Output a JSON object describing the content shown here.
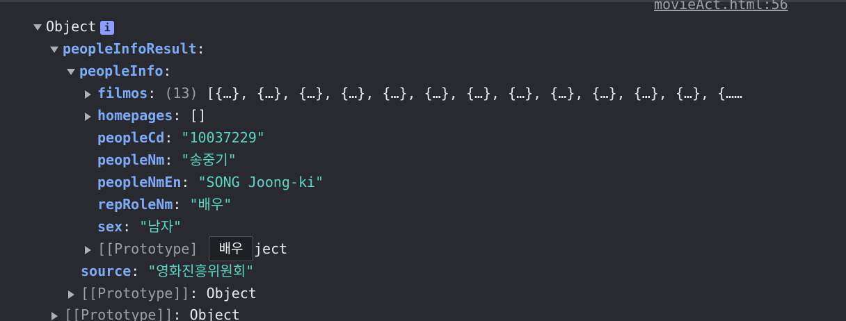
{
  "source_link": "movieAct.html:56",
  "root": {
    "label": "Object",
    "info_icon": "i"
  },
  "peopleInfoResult": {
    "key": "peopleInfoResult",
    "colon": ":"
  },
  "peopleInfo": {
    "key": "peopleInfo",
    "colon": ":"
  },
  "filmos": {
    "key": "filmos",
    "colon": ":",
    "count": "(13)",
    "preview": "[{…}, {…}, {…}, {…}, {…}, {…}, {…}, {…}, {…}, {…}, {…}, {…}, {……"
  },
  "homepages": {
    "key": "homepages",
    "colon": ":",
    "value": "[]"
  },
  "peopleCd": {
    "key": "peopleCd",
    "colon": ":",
    "value": "\"10037229\""
  },
  "peopleNm": {
    "key": "peopleNm",
    "colon": ":",
    "value": "\"송중기\""
  },
  "peopleNmEn": {
    "key": "peopleNmEn",
    "colon": ":",
    "value": "\"SONG Joong-ki\""
  },
  "repRoleNm": {
    "key": "repRoleNm",
    "colon": ":",
    "value": "\"배우\""
  },
  "sex": {
    "key": "sex",
    "colon": ":",
    "value": "\"남자\""
  },
  "proto_inner": {
    "key": "[[Prototype]",
    "tail": "ject"
  },
  "source": {
    "key": "source",
    "colon": ":",
    "value": "\"영화진흥위원회\""
  },
  "proto_mid": {
    "key": "[[Prototype]]",
    "colon": ":",
    "value": "Object"
  },
  "proto_outer": {
    "key": "[[Prototype]]",
    "colon": ":",
    "value": "Object"
  },
  "tooltip": {
    "text": "배우"
  }
}
